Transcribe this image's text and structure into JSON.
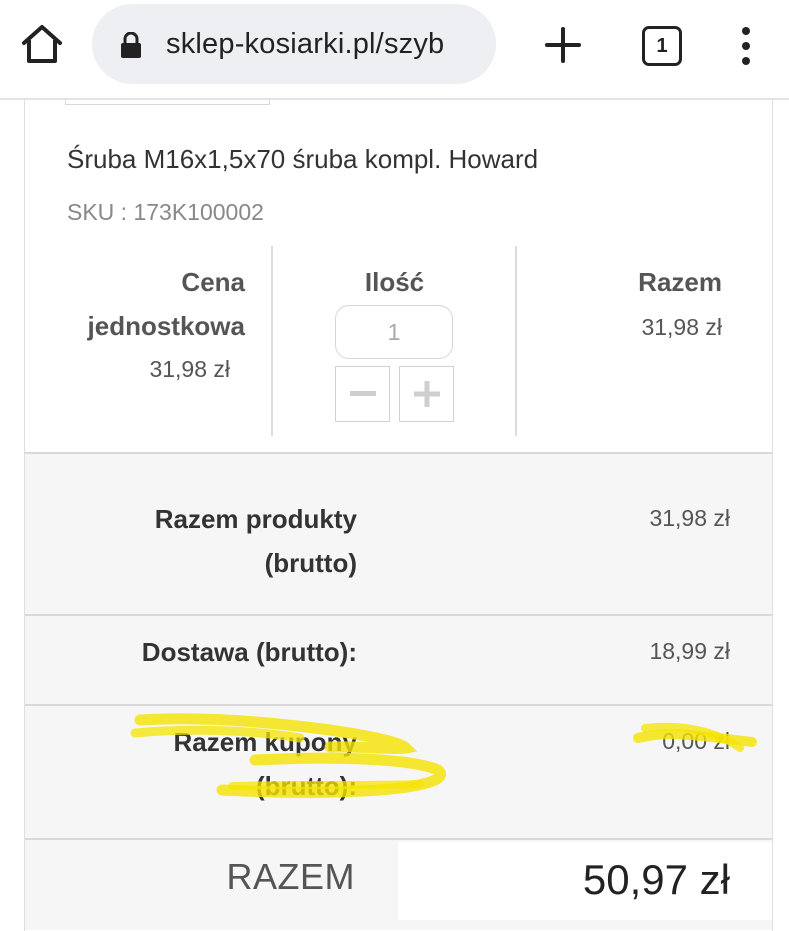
{
  "browser": {
    "url": "sklep-kosiarki.pl/szyb",
    "tab_count": "1",
    "icons": [
      "home-icon",
      "lock-icon",
      "plus-icon",
      "tab-switcher-icon",
      "more-vert-icon"
    ]
  },
  "product": {
    "name": "Śruba M16x1,5x70 śruba kompl. Howard",
    "sku": "SKU : 173K100002"
  },
  "cart_table": {
    "unit_price_header": "Cena jednostkowa",
    "unit_price": "31,98 zł",
    "quantity_header": "Ilość",
    "quantity": "1",
    "total_header": "Razem",
    "line_total": "31,98 zł"
  },
  "summary": {
    "products_label": "Razem produkty (brutto)",
    "products_value": "31,98 zł",
    "shipping_label": "Dostawa (brutto):",
    "shipping_value": "18,99 zł",
    "coupons_label": "Razem kupony (brutto):",
    "coupons_value": "0,00 zł",
    "total_label": "RAZEM",
    "total_value": "50,97 zł"
  },
  "colors": {
    "highlighter": "#f5e400",
    "text_dark": "#333333",
    "text_muted": "#888888",
    "summary_bg": "#f6f6f6"
  }
}
